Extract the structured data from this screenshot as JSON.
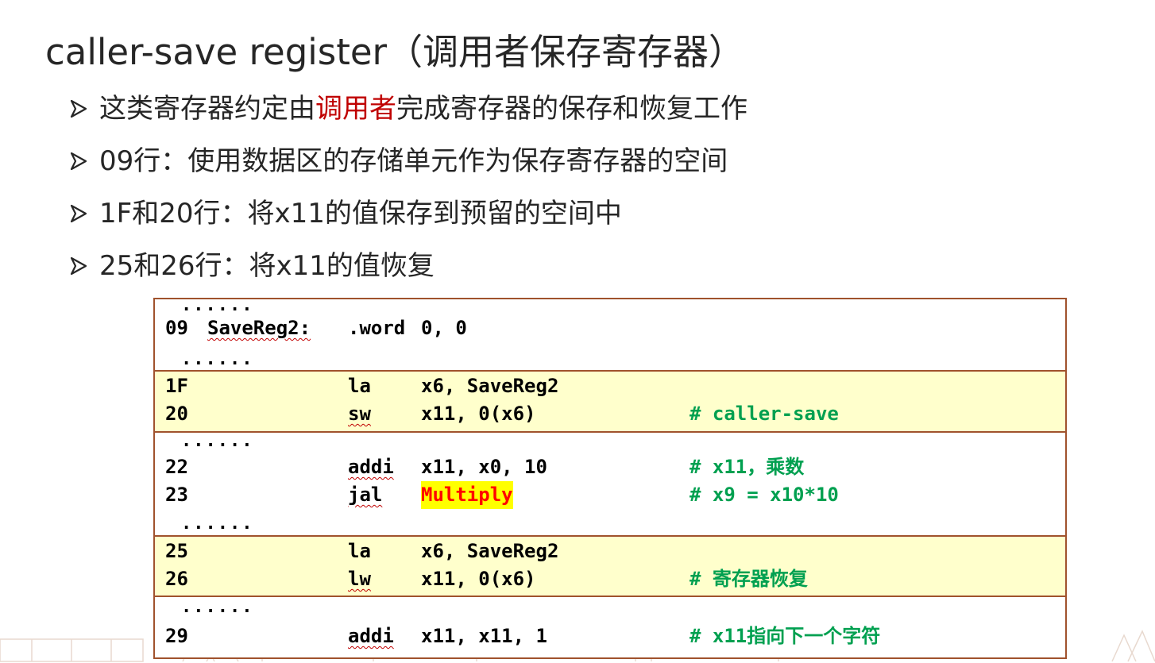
{
  "slide": {
    "title": "caller-save register（调用者保存寄存器）",
    "bullets": [
      {
        "pre": "这类寄存器约定由",
        "highlight": "调用者",
        "post": "完成寄存器的保存和恢复工作"
      },
      {
        "pre": "09行：使用数据区的存储单元作为保存寄存器的空间",
        "highlight": "",
        "post": ""
      },
      {
        "pre": "1F和20行：将x11的值保存到预留的空间中",
        "highlight": "",
        "post": ""
      },
      {
        "pre": "25和26行：将x11的值恢复",
        "highlight": "",
        "post": ""
      }
    ],
    "code": {
      "dots": "......",
      "b1": {
        "line": "09",
        "label": "SaveReg2:",
        "op": ".word",
        "args": "0, 0"
      },
      "b2": [
        {
          "line": "1F",
          "op": "la",
          "args": "x6, SaveReg2",
          "comment": ""
        },
        {
          "line": "20",
          "op": "sw",
          "args": "x11, 0(x6)",
          "comment": "# caller-save"
        }
      ],
      "b3": [
        {
          "line": "22",
          "op": "addi",
          "args": "x11, x0, 10",
          "comment": "# x11，乘数"
        },
        {
          "line": "23",
          "op": "jal",
          "args": "Multiply",
          "comment": "# x9 = x10*10"
        }
      ],
      "b4": [
        {
          "line": "25",
          "op": "la",
          "args": "x6, SaveReg2",
          "comment": ""
        },
        {
          "line": "26",
          "op": "lw",
          "args": "x11, 0(x6)",
          "comment": "# 寄存器恢复"
        }
      ],
      "b5": {
        "line": "29",
        "op": "addi",
        "args": "x11, x11, 1",
        "comment": "# x11指向下一个字符"
      }
    }
  },
  "colors": {
    "accent_red": "#c00000",
    "comment_green": "#00a050",
    "box_border": "#a0522d",
    "block_yellow": "#ffffcc"
  },
  "icons": {
    "bullet": "arrow-bullet-icon"
  }
}
